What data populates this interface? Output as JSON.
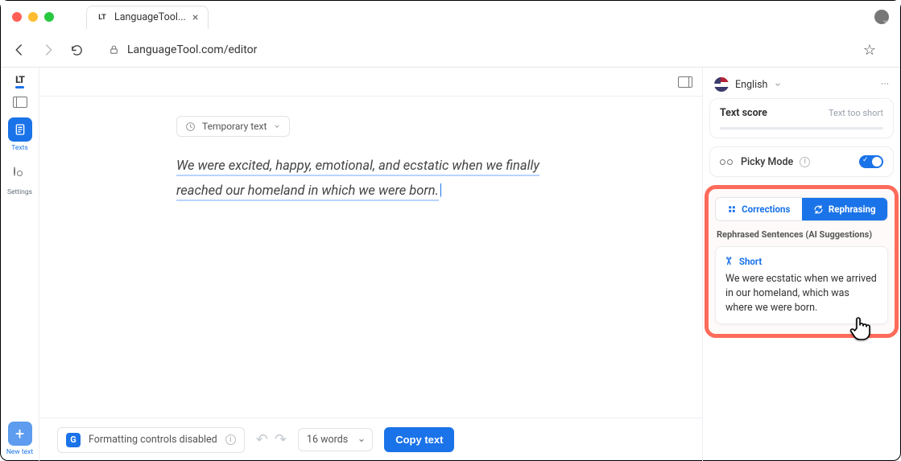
{
  "browser": {
    "tab_title": "LanguageTool...",
    "url": "LanguageTool.com/editor"
  },
  "left_rail": {
    "texts_label": "Texts",
    "settings_label": "Settings",
    "new_text_label": "New text"
  },
  "editor": {
    "temp_text_label": "Temporary text",
    "sentence": "We were excited, happy, emotional, and ecstatic when we finally reached our homeland in which we were born."
  },
  "bottom": {
    "formatting_label": "Formatting controls disabled",
    "word_count_label": "16 words",
    "copy_label": "Copy text"
  },
  "right": {
    "language_label": "English",
    "score_title": "Text score",
    "score_status": "Text too short",
    "picky_label": "Picky Mode",
    "tabs": {
      "corrections": "Corrections",
      "rephrasing": "Rephrasing"
    },
    "rephrase_heading": "Rephrased Sentences (AI Suggestions)",
    "suggestion": {
      "tag": "Short",
      "text": "We were ecstatic when we arrived in our homeland, which was where we were born."
    }
  }
}
